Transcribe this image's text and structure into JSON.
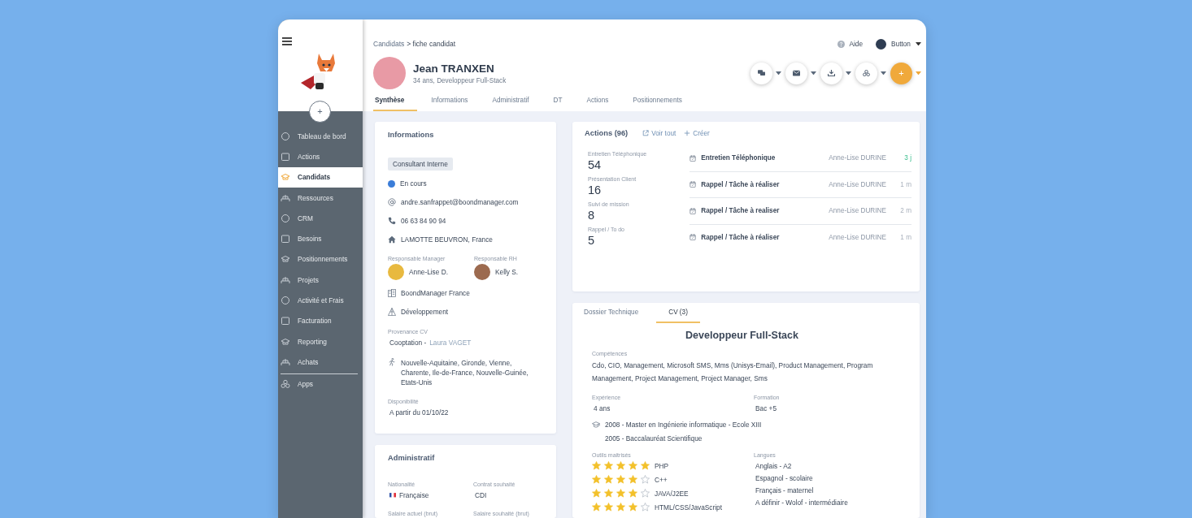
{
  "sidebar": {
    "items": [
      {
        "label": "Tableau de bord",
        "selected": false
      },
      {
        "label": "Actions",
        "selected": false
      },
      {
        "label": "Candidats",
        "selected": true
      },
      {
        "label": "Ressources",
        "selected": false
      },
      {
        "label": "CRM",
        "selected": false
      },
      {
        "label": "Besoins",
        "selected": false
      },
      {
        "label": "Positionnements",
        "selected": false
      },
      {
        "label": "Projets",
        "selected": false
      },
      {
        "label": "Activité et Frais",
        "selected": false
      },
      {
        "label": "Facturation",
        "selected": false
      },
      {
        "label": "Reporting",
        "selected": false
      },
      {
        "label": "Achats",
        "selected": false
      }
    ],
    "bottom_items": [
      {
        "label": "Apps",
        "selected": false
      }
    ],
    "add_button": "+"
  },
  "header": {
    "breadcrumb": {
      "parent": "Candidats",
      "current": "> fiche candidat"
    },
    "help": "Aide",
    "user_button": "Button",
    "candidate": {
      "name": "Jean TRANXEN",
      "subtitle": "34 ans, Developpeur Full-Stack"
    },
    "action_buttons": [
      {
        "kind": "chat"
      },
      {
        "kind": "mail"
      },
      {
        "kind": "download"
      },
      {
        "kind": "share"
      },
      {
        "kind": "add",
        "label": "+"
      }
    ],
    "tabs": [
      {
        "label": "Synthèse",
        "selected": true
      },
      {
        "label": "Informations",
        "selected": false
      },
      {
        "label": "Administratif",
        "selected": false
      },
      {
        "label": "DT",
        "selected": false
      },
      {
        "label": "Actions",
        "selected": false
      },
      {
        "label": "Positionnements",
        "selected": false
      }
    ]
  },
  "informations": {
    "title": "Informations",
    "tag": "Consultant Interne",
    "status": {
      "label": "En cours",
      "color": "#3b7dd8"
    },
    "contacts": [
      {
        "kind": "email",
        "text": "andre.sanfrappet@boondmanager.com"
      },
      {
        "kind": "phone",
        "text": "06 63 84 90 94"
      },
      {
        "kind": "home",
        "text": "LAMOTTE BEUVRON, France"
      }
    ],
    "managers": [
      {
        "label": "Responsable Manager",
        "name": "Anne-Lise D."
      },
      {
        "label": "Responsable RH",
        "name": "Kelly S."
      }
    ],
    "details": [
      {
        "kind": "company",
        "text": "BoondManager France"
      },
      {
        "kind": "department",
        "text": "Développement"
      }
    ],
    "provenance": {
      "label": "Provenance CV",
      "value": "Cooptation -",
      "link": "Laura VAGET"
    },
    "mobility": "Nouvelle-Aquitaine, Gironde, Vienne, Charente, Ile-de-France, Nouvelle-Guinée, Etats-Unis",
    "availability": {
      "label": "Disponibilité",
      "value": "A partir du 01/10/22"
    }
  },
  "administratif": {
    "title": "Administratif",
    "fields": [
      {
        "label": "Nationalité",
        "value": "Française",
        "flag": true
      },
      {
        "label": "Contrat souhaité",
        "value": "CDI"
      },
      {
        "label": "Salaire actuel (brut)"
      },
      {
        "label": "Salaire souhaité (brut)"
      }
    ]
  },
  "actions": {
    "title": "Actions (96)",
    "see_all": "Voir tout",
    "create": "Créer",
    "stats": [
      {
        "label": "Entretien Téléphonique",
        "value": "54"
      },
      {
        "label": "Présentation Client",
        "value": "16"
      },
      {
        "label": "Suivi de mission",
        "value": "8"
      },
      {
        "label": "Rappel / To do",
        "value": "5"
      }
    ],
    "entries": [
      {
        "type": "Entretien Téléphonique",
        "owner": "Anne-Lise DURINE",
        "age": "3 j",
        "recent": true
      },
      {
        "type": "Rappel / Tâche à réaliser",
        "owner": "Anne-Lise DURINE",
        "age": "1 m",
        "recent": false
      },
      {
        "type": "Rappel / Tâche à realiser",
        "owner": "Anne-Lise DURINE",
        "age": "2 m",
        "recent": false
      },
      {
        "type": "Rappel / Tâche à réaliser",
        "owner": "Anne-Lise DURINE",
        "age": "1 m",
        "recent": false
      }
    ]
  },
  "cv": {
    "tabs": [
      {
        "label": "Dossier Technique",
        "selected": false
      },
      {
        "label": "CV (3)",
        "selected": true
      }
    ],
    "title": "Developpeur Full-Stack",
    "skills": {
      "label": "Compétences",
      "text": "Cdo, CIO, Management, Microsoft SMS, Mms (Unisys-Email), Product Management, Program Management, Project Management, Project Manager, Sms"
    },
    "experience": {
      "label": "Expérience",
      "value": "4 ans"
    },
    "education": {
      "label": "Formation",
      "value": "Bac +5"
    },
    "diplomas": [
      "2008 - Master en Ingénierie informatique - Ecole XIII",
      "2005 - Baccalauréat Scientifique"
    ],
    "tools_label": "Outils maitrisés",
    "tools": [
      {
        "name": "PHP",
        "stars": 5
      },
      {
        "name": "C++",
        "stars": 4
      },
      {
        "name": "JAVA/J2EE",
        "stars": 4
      },
      {
        "name": "HTML/CSS/JavaScript",
        "stars": 4
      }
    ],
    "languages_label": "Langues",
    "languages": [
      "Anglais - A2",
      "Espagnol - scolaire",
      "Français - maternel",
      "A définir - Wolof - intermédiaire"
    ]
  }
}
